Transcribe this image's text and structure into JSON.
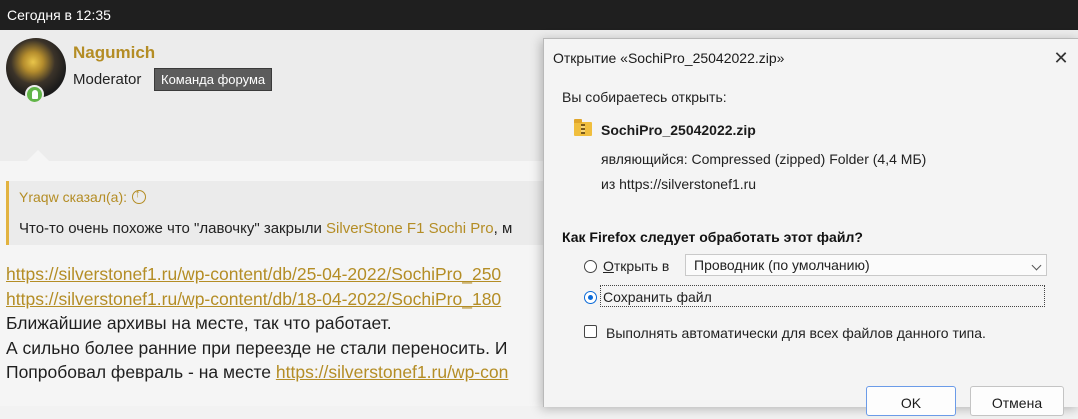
{
  "header": {
    "timestamp": "Сегодня в 12:35"
  },
  "author": {
    "username": "Nagumich",
    "role": "Moderator",
    "badge": "Команда форума"
  },
  "quote": {
    "author_label": "Yraqw сказал(а):",
    "text_prefix": "Что-то очень похоже что \"лавочку\" закрыли ",
    "text_link": "SilverStone F1 Sochi Pro",
    "text_suffix": ", м"
  },
  "post": {
    "line1_link": "https://silverstonef1.ru/wp-content/db/25-04-2022/SochiPro_250",
    "line2_link": "https://silverstonef1.ru/wp-content/db/18-04-2022/SochiPro_180",
    "line3": "Ближайшие архивы на месте, так что работает.",
    "line4": "А сильно более ранние при переезде не стали переносить. И",
    "line5_prefix": "Попробовал февраль - на месте ",
    "line5_link": "https://silverstonef1.ru/wp-con"
  },
  "dialog": {
    "title": "Открытие «SochiPro_25042022.zip»",
    "close_glyph": "✕",
    "prompt": "Вы собираетесь открыть:",
    "file_icon": "zip-folder-icon",
    "file_name": "SochiPro_25042022.zip",
    "file_type": "являющийся:  Compressed (zipped) Folder (4,4 МБ)",
    "file_source": "из  https://silverstonef1.ru",
    "question": "Как Firefox следует обработать этот файл?",
    "open_with_label": "Открыть в",
    "open_with_value": "Проводник (по умолчанию)",
    "save_label": "Сохранить файл",
    "selected_option": "save",
    "auto_label": "Выполнять автоматически для всех файлов данного типа.",
    "auto_checked": false,
    "ok_label": "OK",
    "cancel_label": "Отмена"
  },
  "colors": {
    "accent": "#b48d25",
    "topbar": "#1f1f1f",
    "online": "#62b548",
    "radio_selected": "#0a6ad8"
  }
}
